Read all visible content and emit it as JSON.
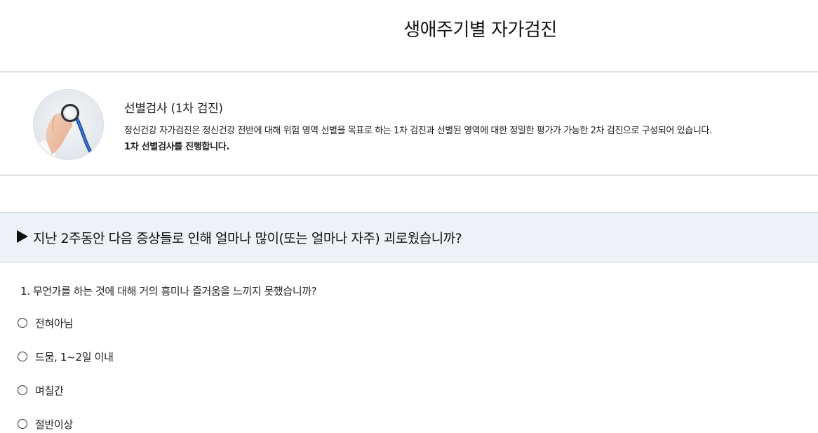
{
  "page": {
    "title": "생애주기별 자가검진"
  },
  "intro": {
    "image_icon": "stethoscope-hand-image",
    "heading": "선별검사 (1차 검진)",
    "description": "정신건강 자가검진은 정신건강 전반에 대해 위험 영역 선별을 목표로 하는 1차 검진과 선별된 영역에 대한 정밀한 평가가 가능한 2차 검진으로 구성되어 있습니다.",
    "instruction": "1차 선별검사를 진행합니다."
  },
  "banner": {
    "icon": "right-triangle-icon",
    "text": "지난 2주동안 다음 증상들로 인해 얼마나 많이(또는 얼마나 자주) 괴로웠습니까?"
  },
  "question": {
    "text": "1. 무언가를 하는 것에 대해 거의 흥미나 즐거움을 느끼지 못했습니까?",
    "options": [
      {
        "label": "전혀아님",
        "selected": false
      },
      {
        "label": "드뭄, 1~2일 이내",
        "selected": false
      },
      {
        "label": "며칠간",
        "selected": false
      },
      {
        "label": "절반이상",
        "selected": false
      }
    ]
  },
  "colors": {
    "divider": "#a9b7c2",
    "banner_bg": "#eef2f6",
    "text": "#222222"
  }
}
